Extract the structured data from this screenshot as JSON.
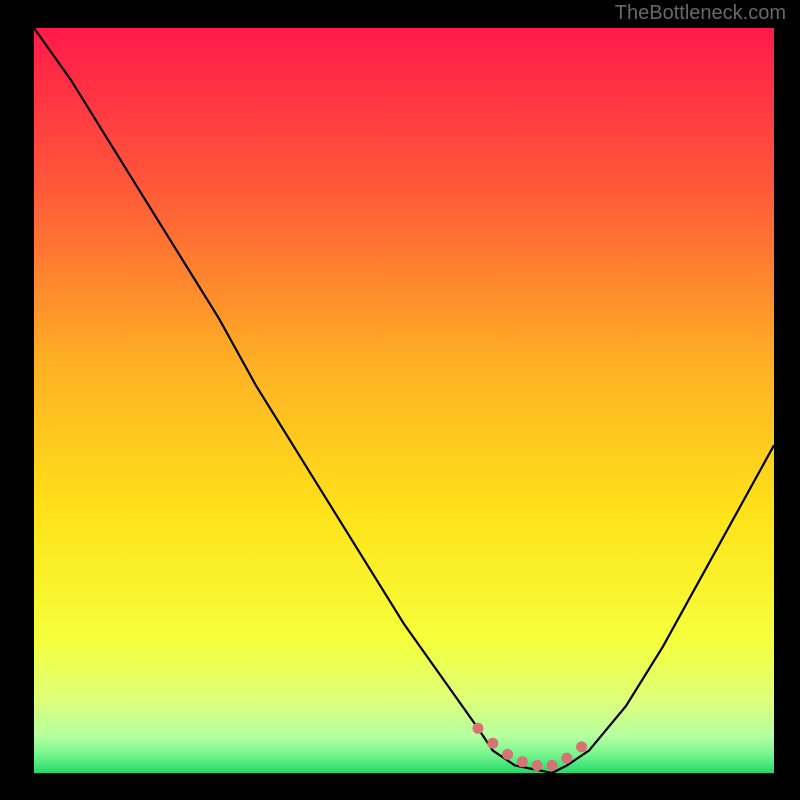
{
  "watermark": "TheBottleneck.com",
  "chart_data": {
    "type": "line",
    "title": "",
    "xlabel": "",
    "ylabel": "",
    "xlim": [
      0,
      100
    ],
    "ylim": [
      0,
      100
    ],
    "series": [
      {
        "name": "bottleneck-curve",
        "x": [
          0,
          5,
          10,
          15,
          20,
          25,
          30,
          35,
          40,
          45,
          50,
          55,
          60,
          62,
          65,
          70,
          72,
          75,
          80,
          85,
          90,
          95,
          100
        ],
        "y": [
          100,
          93,
          85,
          77,
          69,
          61,
          52,
          44,
          36,
          28,
          20,
          13,
          6,
          3,
          1,
          0,
          1,
          3,
          9,
          17,
          26,
          35,
          44
        ]
      }
    ],
    "markers": {
      "name": "trough-markers",
      "points_x": [
        60,
        62,
        64,
        66,
        68,
        70,
        72,
        74
      ],
      "points_y": [
        6,
        4,
        2.5,
        1.5,
        1,
        1,
        2,
        3.5
      ],
      "color": "#d67373"
    },
    "background": {
      "type": "vertical-gradient",
      "stops": [
        {
          "pos": 0.0,
          "color": "#ff1a4b"
        },
        {
          "pos": 0.22,
          "color": "#ff5a38"
        },
        {
          "pos": 0.45,
          "color": "#ffb024"
        },
        {
          "pos": 0.65,
          "color": "#ffe21a"
        },
        {
          "pos": 0.82,
          "color": "#f5ff3a"
        },
        {
          "pos": 0.9,
          "color": "#dfff78"
        },
        {
          "pos": 0.95,
          "color": "#b6ffa0"
        },
        {
          "pos": 0.975,
          "color": "#78f58e"
        },
        {
          "pos": 1.0,
          "color": "#22d96b"
        }
      ]
    }
  }
}
